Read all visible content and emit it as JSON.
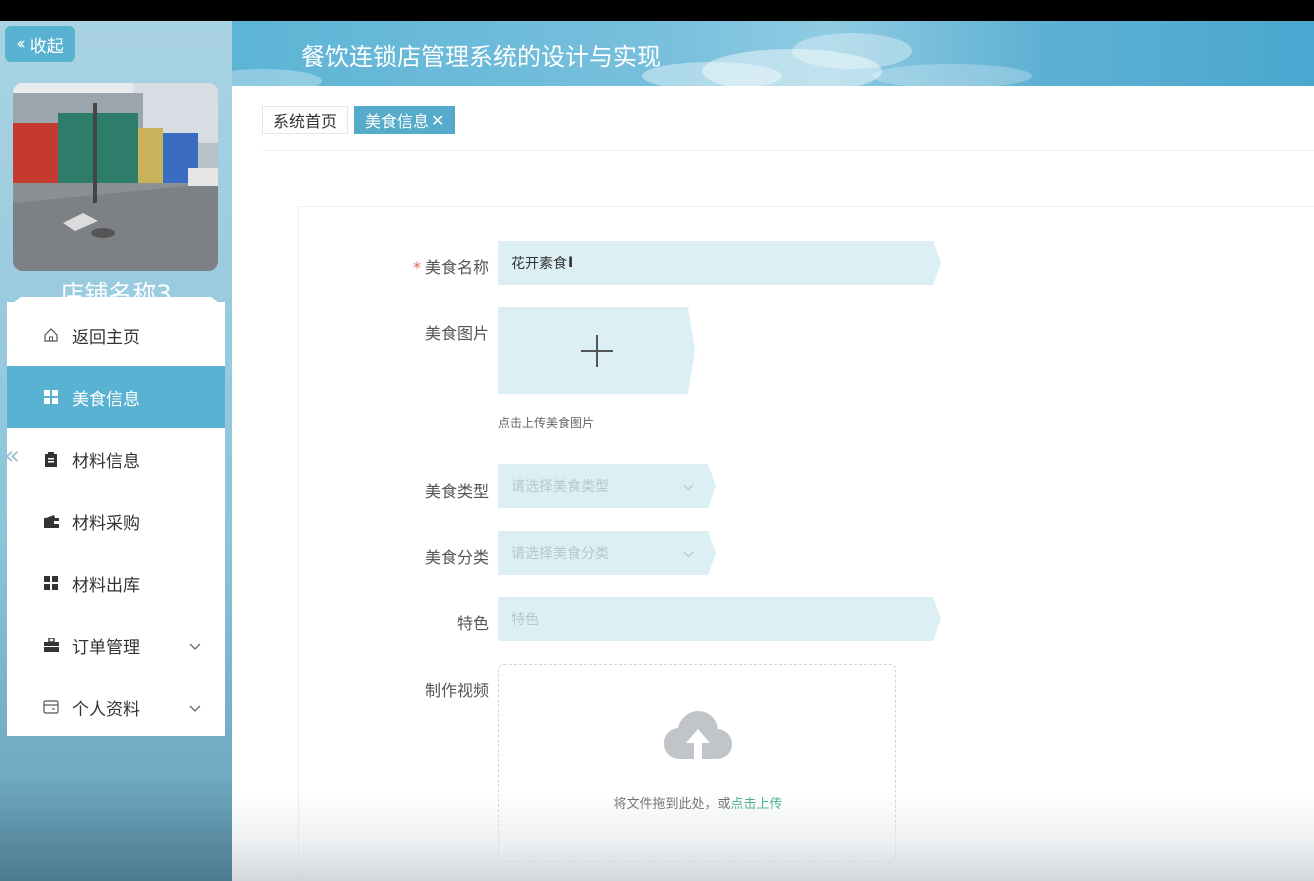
{
  "app": {
    "title": "餐饮连锁店管理系统的设计与实现",
    "collapse_label": "收起",
    "shop_name": "店铺名称3"
  },
  "sidebar": {
    "items": [
      {
        "label": "返回主页",
        "icon": "home-icon",
        "active": false
      },
      {
        "label": "美食信息",
        "icon": "grid-icon",
        "active": true
      },
      {
        "label": "材料信息",
        "icon": "clipboard-icon",
        "active": false
      },
      {
        "label": "材料采购",
        "icon": "wallet-icon",
        "active": false
      },
      {
        "label": "材料出库",
        "icon": "grid-icon",
        "active": false
      },
      {
        "label": "订单管理",
        "icon": "briefcase-icon",
        "active": false,
        "expandable": true
      },
      {
        "label": "个人资料",
        "icon": "card-icon",
        "active": false,
        "expandable": true
      }
    ]
  },
  "tabs": [
    {
      "label": "系统首页",
      "active": false
    },
    {
      "label": "美食信息",
      "active": true,
      "close": "✕"
    }
  ],
  "form": {
    "name_label": "美食名称",
    "name_required": "*",
    "name_value": "花开素食",
    "image_label": "美食图片",
    "image_hint": "点击上传美食图片",
    "type_label": "美食类型",
    "type_placeholder": "请选择美食类型",
    "category_label": "美食分类",
    "category_placeholder": "请选择美食分类",
    "feature_label": "特色",
    "feature_placeholder": "特色",
    "video_label": "制作视频",
    "video_drop_text": "将文件拖到此处，或",
    "video_drop_link": "点击上传"
  },
  "colors": {
    "accent": "#5ab2d2",
    "field_bg": "#dceff5",
    "link": "#3eaa88"
  }
}
